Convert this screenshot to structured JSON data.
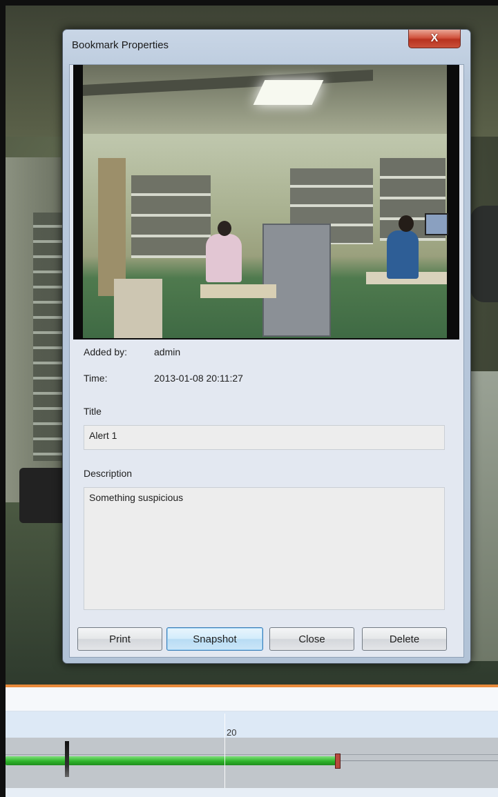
{
  "dialog": {
    "title": "Bookmark Properties",
    "close_glyph": "X"
  },
  "details": {
    "added_by_label": "Added by:",
    "added_by_value": "admin",
    "time_label": "Time:",
    "time_value": "2013-01-08 20:11:27",
    "title_label": "Title",
    "title_value": "Alert 1",
    "description_label": "Description",
    "description_value": "Something suspicious"
  },
  "buttons": {
    "print": "Print",
    "snapshot": "Snapshot",
    "close": "Close",
    "delete": "Delete"
  },
  "timeline": {
    "tick_label": "20"
  },
  "colors": {
    "timeline_accent": "#e98a3a",
    "recording_green": "#2fb42b",
    "close_button_red": "#c9503a",
    "default_button_border": "#3a7cb6"
  }
}
